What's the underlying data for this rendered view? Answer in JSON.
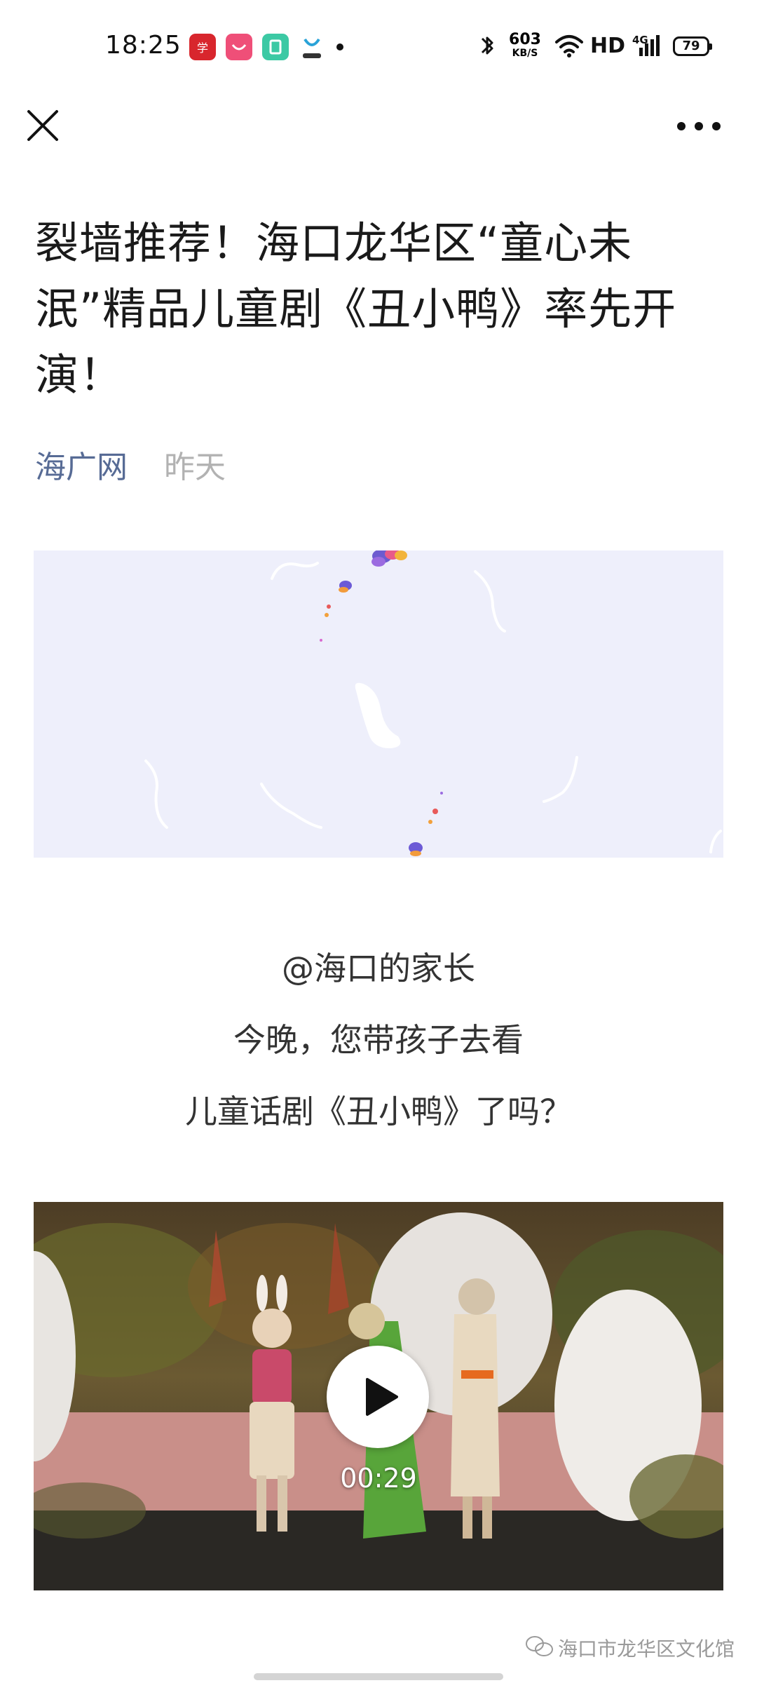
{
  "status_bar": {
    "time": "18:25",
    "network_speed_value": "603",
    "network_speed_unit": "KB/S",
    "hd_label": "HD",
    "network_type": "4G",
    "battery_level": "79"
  },
  "article": {
    "title": "裂墙推荐！海口龙华区“童心未泯”精品儿童剧《丑小鸭》率先开演！",
    "source": "海广网",
    "time": "昨天",
    "lines": [
      "@海口的家长",
      "今晚，您带孩子去看",
      "儿童话剧《丑小鸭》了吗？"
    ],
    "video": {
      "duration": "00:29"
    },
    "watermark": "海口市龙华区文化馆"
  },
  "colors": {
    "source_link": "#576b95",
    "meta_gray": "#b2b2b2",
    "banner_bg": "#eeeffb"
  },
  "icons": [
    "close-icon",
    "more-icon",
    "play-icon",
    "wechat-icon",
    "bluetooth-icon",
    "wifi-icon",
    "signal-icon",
    "battery-icon"
  ]
}
